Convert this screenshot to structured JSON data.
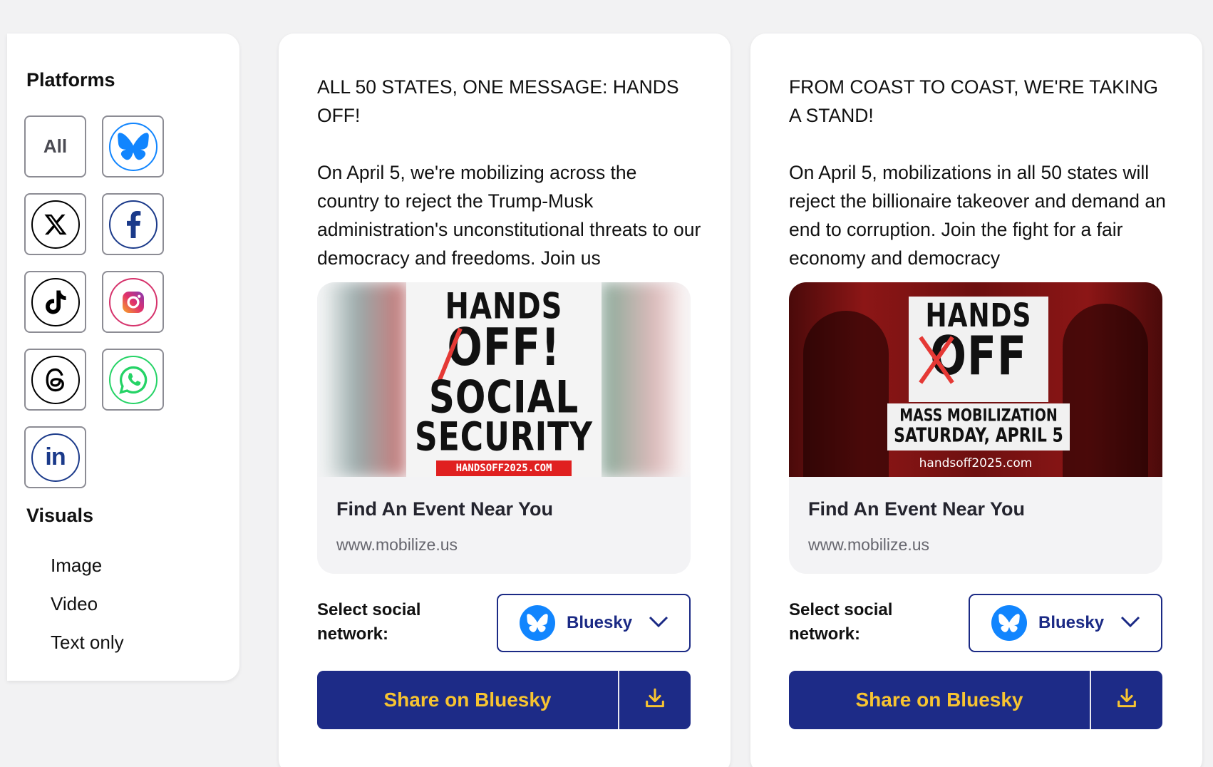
{
  "sidebar": {
    "platforms_heading": "Platforms",
    "platform_all_label": "All",
    "platforms": [
      {
        "name": "bluesky",
        "icon": "butterfly-icon",
        "color": "#1185fe"
      },
      {
        "name": "x",
        "icon": "x-logo-icon",
        "color": "#000000"
      },
      {
        "name": "facebook",
        "icon": "facebook-icon",
        "color": "#1b3a8a"
      },
      {
        "name": "tiktok",
        "icon": "tiktok-icon",
        "color": "#000000"
      },
      {
        "name": "instagram",
        "icon": "instagram-icon",
        "color": "#d6336c"
      },
      {
        "name": "threads",
        "icon": "threads-icon",
        "color": "#000000"
      },
      {
        "name": "whatsapp",
        "icon": "whatsapp-icon",
        "color": "#25d366"
      },
      {
        "name": "linkedin",
        "icon": "linkedin-icon",
        "color": "#1b3a8a"
      }
    ],
    "visuals_heading": "Visuals",
    "visuals": [
      "Image",
      "Video",
      "Text only"
    ]
  },
  "cards": [
    {
      "headline": "ALL 50 STATES, ONE MESSAGE: HANDS OFF!",
      "body": "On April 5, we're mobilizing across the country to reject the Trump-Musk administration's unconstitutional threats to our democracy and freedoms. Join us",
      "image_text": {
        "line1": "HANDS",
        "line2": "OFF!",
        "line3": "SOCIAL",
        "line4": "SECURITY",
        "url": "HANDSOFF2025.COM"
      },
      "link_title": "Find An Event Near You",
      "link_url": "www.mobilize.us",
      "select_label": "Select social network:",
      "select_value": "Bluesky",
      "share_label": "Share on Bluesky"
    },
    {
      "headline": "FROM COAST TO COAST, WE'RE TAKING A STAND!",
      "body": "On April 5, mobilizations in all 50 states will reject the billionaire takeover and demand an end to corruption. Join the fight for a fair economy and democracy",
      "image_text": {
        "line1": "HANDS",
        "line2": "OFF",
        "line3": "MASS MOBILIZATION",
        "line4": "SATURDAY, APRIL 5",
        "url": "handsoff2025.com"
      },
      "link_title": "Find An Event Near You",
      "link_url": "www.mobilize.us",
      "select_label": "Select social network:",
      "select_value": "Bluesky",
      "share_label": "Share on Bluesky"
    }
  ],
  "colors": {
    "navy": "#1d2b87",
    "gold": "#f7c431",
    "bluesky": "#1185fe"
  }
}
